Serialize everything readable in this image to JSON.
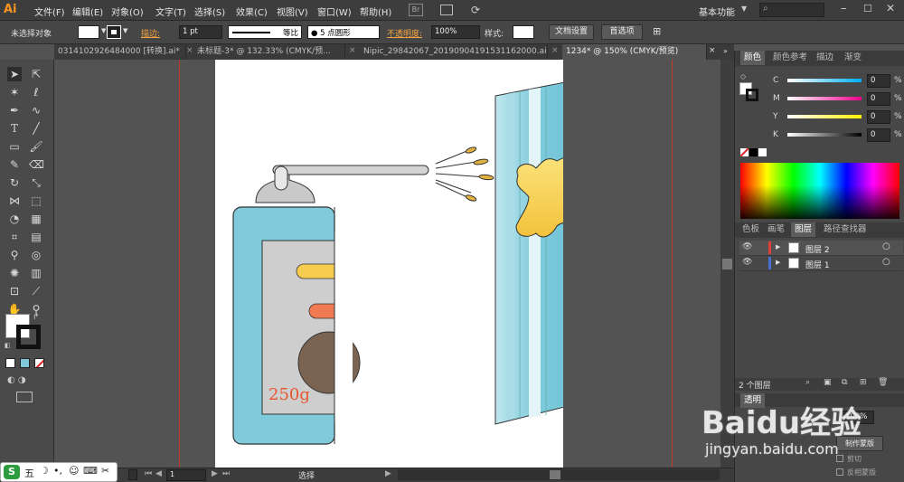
{
  "app": {
    "logo": "Ai",
    "workspace": "基本功能",
    "search_placeholder": ""
  },
  "menu": [
    "文件(F)",
    "编辑(E)",
    "对象(O)",
    "文字(T)",
    "选择(S)",
    "效果(C)",
    "视图(V)",
    "窗口(W)",
    "帮助(H)"
  ],
  "menu_extras": {
    "br": "Br"
  },
  "options": {
    "selection_label": "未选择对象",
    "stroke_label": "描边:",
    "stroke_value": "1 pt",
    "stroke_profile": "等比",
    "brush": "5 点圆形",
    "opacity_label": "不透明度:",
    "opacity_value": "100%",
    "style_label": "样式:",
    "doc_setup": "文档设置",
    "prefs": "首选项"
  },
  "tabs": [
    {
      "label": "0314102926484000 [转换].ai*",
      "active": false
    },
    {
      "label": "未标题-3* @ 132.33% (CMYK/预...",
      "active": false
    },
    {
      "label": "Nipic_29842067_20190904191531162000.ai*",
      "active": false
    },
    {
      "label": "1234* @ 150% (CMYK/预览)",
      "active": true
    }
  ],
  "artwork": {
    "can_label": "250g"
  },
  "color_panel": {
    "tabs": [
      "颜色",
      "颜色参考",
      "描边",
      "渐变"
    ],
    "channels": [
      {
        "name": "C",
        "value": "0",
        "color": "#00aeef"
      },
      {
        "name": "M",
        "value": "0",
        "color": "#ec008c"
      },
      {
        "name": "Y",
        "value": "0",
        "color": "#fff200"
      },
      {
        "name": "K",
        "value": "0",
        "color": "#000000"
      }
    ],
    "percent": "%"
  },
  "layers_panel": {
    "tabs": [
      "色板",
      "画笔",
      "图层",
      "路径查找器"
    ],
    "layers": [
      {
        "name": "图层 2",
        "color": "#e0403a"
      },
      {
        "name": "图层 1",
        "color": "#4a6fd0"
      }
    ],
    "count": "2 个图层"
  },
  "transparency_panel": {
    "tab": "透明",
    "opacity": "100%",
    "make_mask": "制作蒙版",
    "clip": "剪切",
    "invert": "反相蒙版"
  },
  "status": {
    "zoom": "150%",
    "page": "1",
    "tool": "选择"
  },
  "watermark": {
    "brand": "Baidu经验",
    "url": "jingyan.baidu.com"
  },
  "ime": {
    "mode": "五"
  }
}
